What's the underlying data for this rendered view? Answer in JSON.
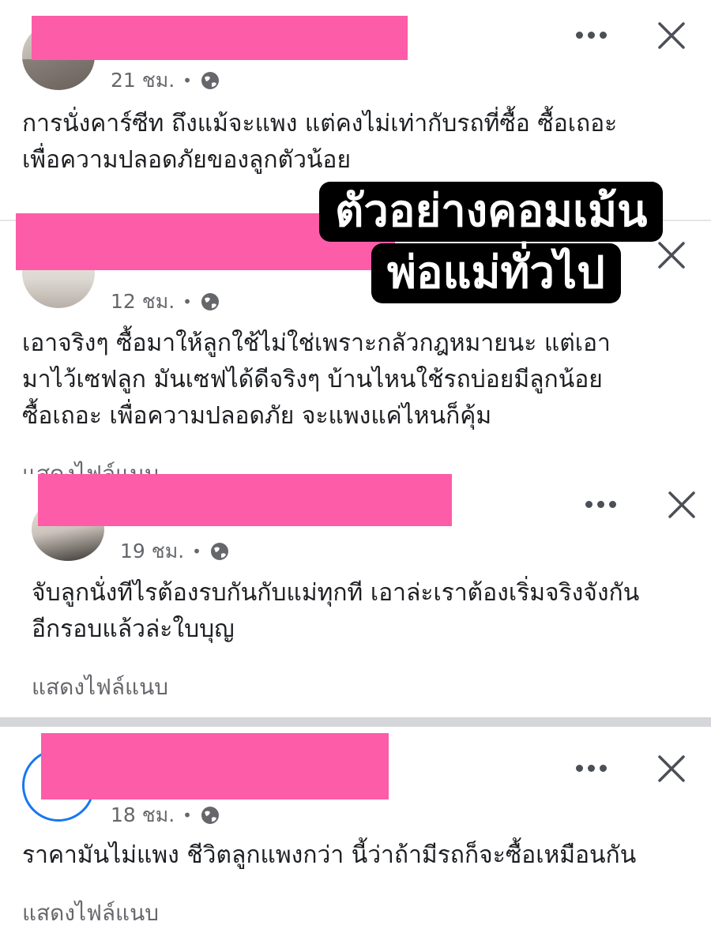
{
  "comments": [
    {
      "time": "21 ชม.",
      "lines": [
        "การนั่งคาร์ซีท ถึงแม้จะแพง แต่คงไม่เท่ากับรถที่ซื้อ ซื้อเถอะ",
        "เพื่อความปลอดภัยของลูกตัวน้อย"
      ]
    },
    {
      "time": "12 ชม.",
      "lines": [
        "เอาจริงๆ ซื้อมาให้ลูกใช้ไม่ใช่เพราะกลัวกฎหมายนะ แต่เอา",
        "มาไว้เซฟลูก   มันเซฟได้ดีจริงๆ  บ้านไหนใช้รถบ่อยมีลูกน้อย",
        "ซื้อเถอะ เพื่อความปลอดภัย จะแพงแค่ไหนก็คุ้ม"
      ],
      "attachment": "แสดงไฟล์แนบ"
    },
    {
      "time": "19 ชม.",
      "lines": [
        "จับลูกนั่งทีไรต้องรบกันกับแม่ทุกที เอาล่ะเราต้องเริ่มจริงจังกัน",
        "อีกรอบแล้วล่ะใบบุญ"
      ],
      "attachment": "แสดงไฟล์แนบ"
    },
    {
      "time": "18 ชม.",
      "lines": [
        "ราคามันไม่แพง ชีวิตลูกแพงกว่า นี้ว่าถ้ามีรถก็จะซื้อเหมือนกัน"
      ],
      "attachment": "แสดงไฟล์แนบ"
    }
  ],
  "overlay": {
    "line1": "ตัวอย่างคอมเม้น",
    "line2": "พ่อแม่ทั่วไป"
  },
  "colors": {
    "redaction": "#fd5ca8",
    "meta_text": "#65676b",
    "divider": "#d4d6d9"
  },
  "icons": [
    "more-options-icon",
    "close-icon",
    "globe-icon"
  ]
}
